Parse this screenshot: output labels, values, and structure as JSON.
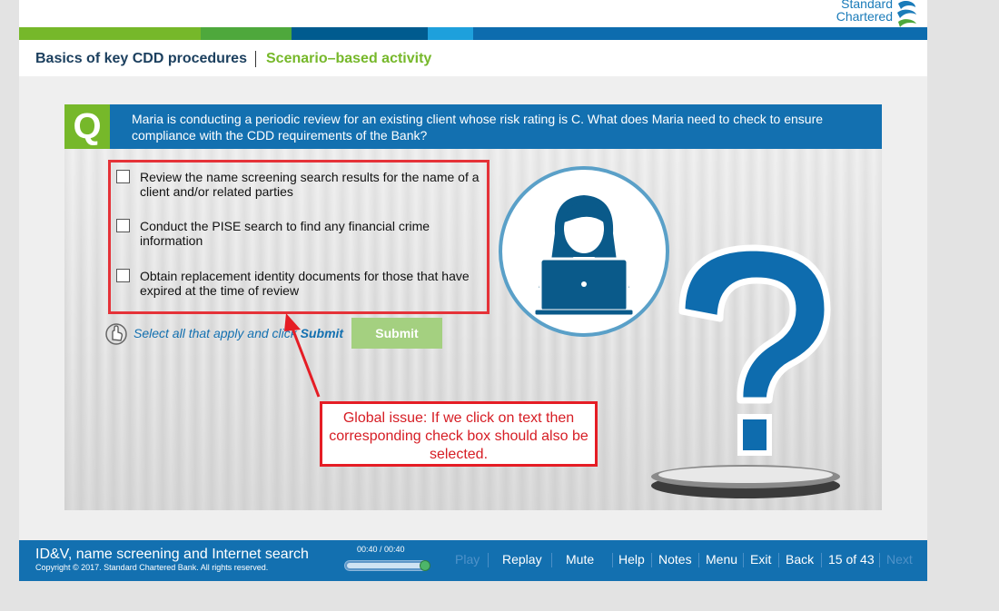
{
  "brand": {
    "line1": "Standard",
    "line2": "Chartered"
  },
  "header": {
    "course_title": "Basics of key CDD procedures",
    "activity_title": "Scenario–based activity"
  },
  "question": {
    "badge": "Q",
    "text": "Maria is conducting a periodic review for an existing client whose risk rating is C. What does Maria need to check to ensure compliance with the CDD requirements of the Bank?"
  },
  "options": [
    {
      "label": "Review the name screening search results for the name of a client and/or related parties",
      "checked": false
    },
    {
      "label": "Conduct the PISE search to find any financial crime information",
      "checked": false
    },
    {
      "label": "Obtain replacement identity documents for those that have expired at the time of review",
      "checked": false
    }
  ],
  "instruction": {
    "text": "Select all that apply and click ",
    "emphasis": "Submit"
  },
  "submit_label": "Submit",
  "annotation": "Global issue: If we click on text then corresponding check box should also be selected.",
  "footer": {
    "title": "ID&V, name screening and Internet search",
    "copyright": "Copyright © 2017. Standard Chartered Bank. All rights reserved.",
    "time": "00:40 / 00:40",
    "progress": 1.0,
    "nav": {
      "play": "Play",
      "replay": "Replay",
      "mute": "Mute",
      "help": "Help",
      "notes": "Notes",
      "menu": "Menu",
      "exit": "Exit",
      "back": "Back",
      "page": "15 of 43",
      "next": "Next"
    }
  },
  "colors": {
    "brand_blue": "#1370b0",
    "brand_green": "#76b82a",
    "annotation_red": "#e51d25"
  }
}
